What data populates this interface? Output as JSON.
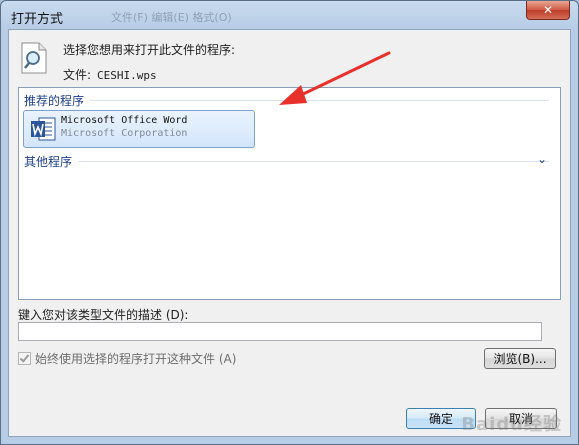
{
  "window": {
    "title": "打开方式",
    "ghost_text": "文件(F)   编辑(E)   格式(O)",
    "close_symbol": "✕"
  },
  "header": {
    "prompt": "选择您想用来打开此文件的程序:",
    "file_label": "文件:",
    "file_name": "CESHI.wps"
  },
  "programs": {
    "recommended_label": "推荐的程序",
    "other_label": "其他程序",
    "other_chevron": "⌄",
    "items": [
      {
        "name": "Microsoft Office Word",
        "company": "Microsoft Corporation"
      }
    ]
  },
  "description": {
    "label": "键入您对该类型文件的描述 (D):",
    "value": "",
    "placeholder": ""
  },
  "options": {
    "always_use_label": "始终使用选择的程序打开这种文件 (A)",
    "always_use_checked": true
  },
  "buttons": {
    "browse": "浏览(B)...",
    "ok": "确定",
    "cancel": "取消"
  },
  "watermark": "Baidu经验",
  "colors": {
    "arrow": "#e8312a",
    "word_blue": "#2a5699"
  }
}
